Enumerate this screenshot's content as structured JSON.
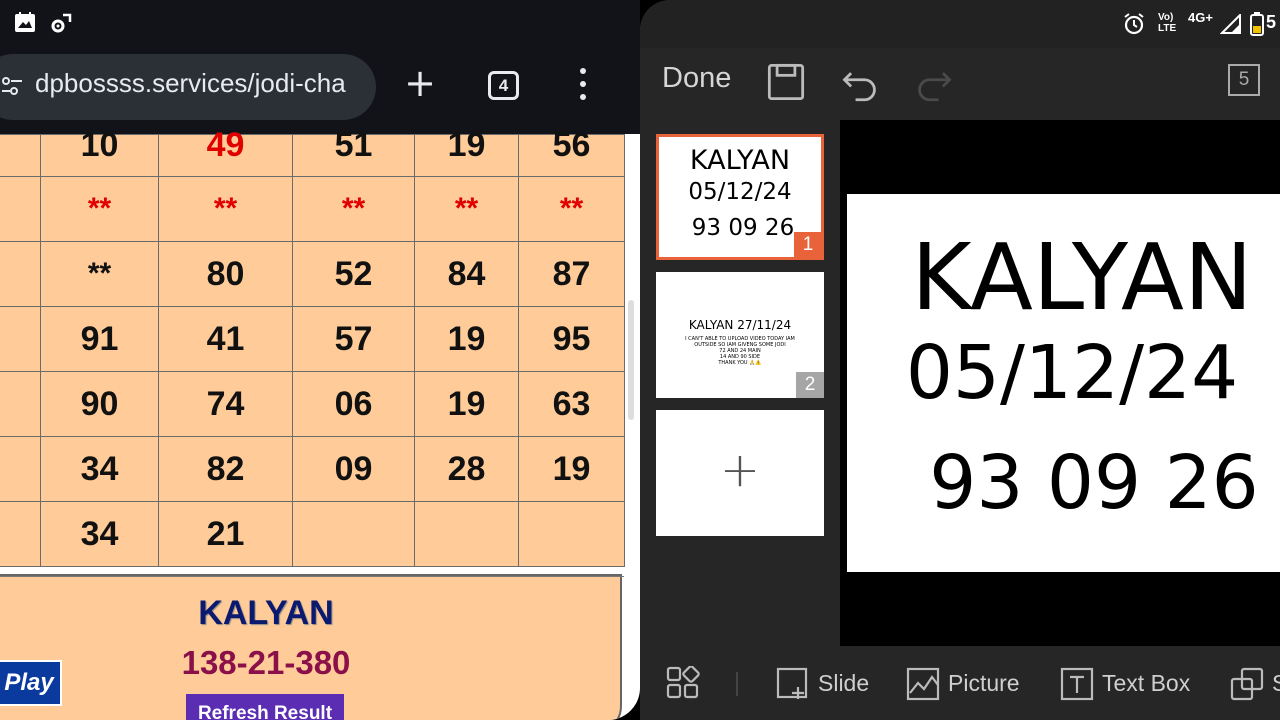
{
  "status_bar": {
    "left_icons": [
      "gallery-icon",
      "settings-sync-icon"
    ],
    "right_icons": [
      "alarm-icon",
      "volte-icon",
      "signal-icon",
      "battery-icon"
    ],
    "volte_label": "Vo) LTE",
    "network": "4G+",
    "battery_text": "5"
  },
  "browser": {
    "url": "dpbossss.services/jodi-cha",
    "tab_count": "4",
    "table_rows": [
      [
        "10",
        "49",
        "51",
        "19",
        "56"
      ],
      [
        "**",
        "**",
        "**",
        "**",
        "**"
      ],
      [
        "**",
        "80",
        "52",
        "84",
        "87"
      ],
      [
        "91",
        "41",
        "57",
        "19",
        "95"
      ],
      [
        "90",
        "74",
        "06",
        "19",
        "63"
      ],
      [
        "34",
        "82",
        "09",
        "28",
        "19"
      ],
      [
        "34",
        "21",
        "",
        "",
        ""
      ]
    ],
    "red_cells": [
      [
        0,
        1
      ],
      [
        1,
        0
      ],
      [
        1,
        1
      ],
      [
        1,
        2
      ],
      [
        1,
        3
      ],
      [
        1,
        4
      ]
    ],
    "result": {
      "market": "KALYAN",
      "value": "138-21-380",
      "play_label": "Play",
      "refresh_label": "Refresh Result"
    }
  },
  "editor": {
    "done_label": "Done",
    "slide_count": "5",
    "thumbnails": [
      {
        "number": "1",
        "lines": [
          "KALYAN",
          "05/12/24",
          "93 09 26"
        ],
        "selected": true
      },
      {
        "number": "2",
        "title": "KALYAN 27/11/24",
        "body": [
          "I CAN'T ABLE TO UPLOAD VIDEO TODAY IAM",
          "OUTSIDE SO IAM GIVENG SOME JODI",
          "72 AND 24 MAIN",
          "14 AND 90 SIDE",
          "THANK YOU 🙏⚠️"
        ],
        "selected": false
      }
    ],
    "main_slide": {
      "line1": "KALYAN",
      "line2": "05/12/24",
      "line3": "93 09 26"
    },
    "bottom_bar": {
      "slide_label": "Slide",
      "picture_label": "Picture",
      "textbox_label": "Text Box",
      "shape_label": "S"
    },
    "accent_color": "#e8623a"
  }
}
